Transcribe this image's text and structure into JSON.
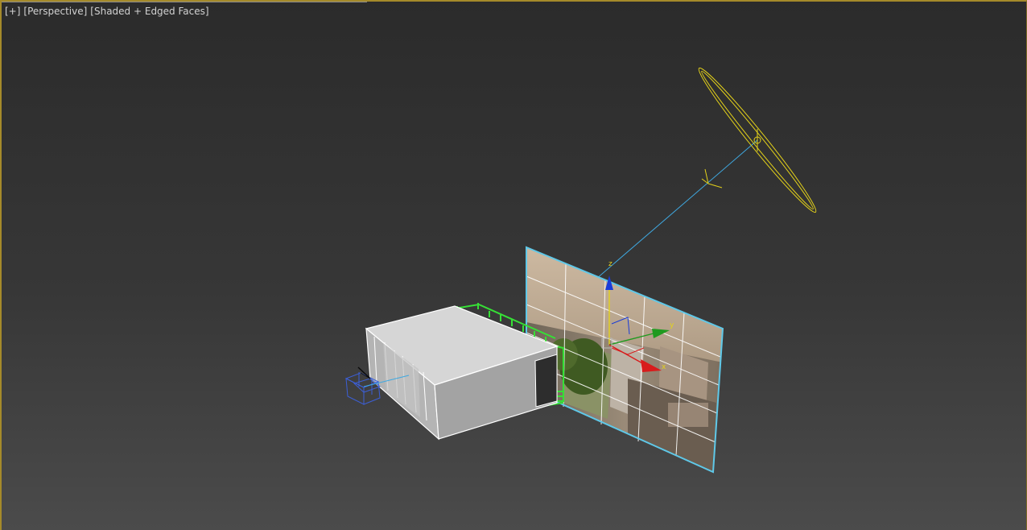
{
  "viewport": {
    "label": {
      "plus_menu": "[+]",
      "view_menu": "[Perspective]",
      "shading_menu": "[Shaded + Edged Faces]"
    }
  },
  "gizmo": {
    "z_label": "z",
    "y_label": "y",
    "x_label": "x"
  },
  "colors": {
    "active_border": "#a58a2a",
    "selection": "#5fc8e8",
    "light_object": "#e4d21a",
    "wire_green": "#36e036",
    "camera_wire": "#3c5fd6",
    "axis_x": "#d81c1c",
    "axis_y": "#1f9a1f",
    "axis_z": "#1a3cd8"
  }
}
